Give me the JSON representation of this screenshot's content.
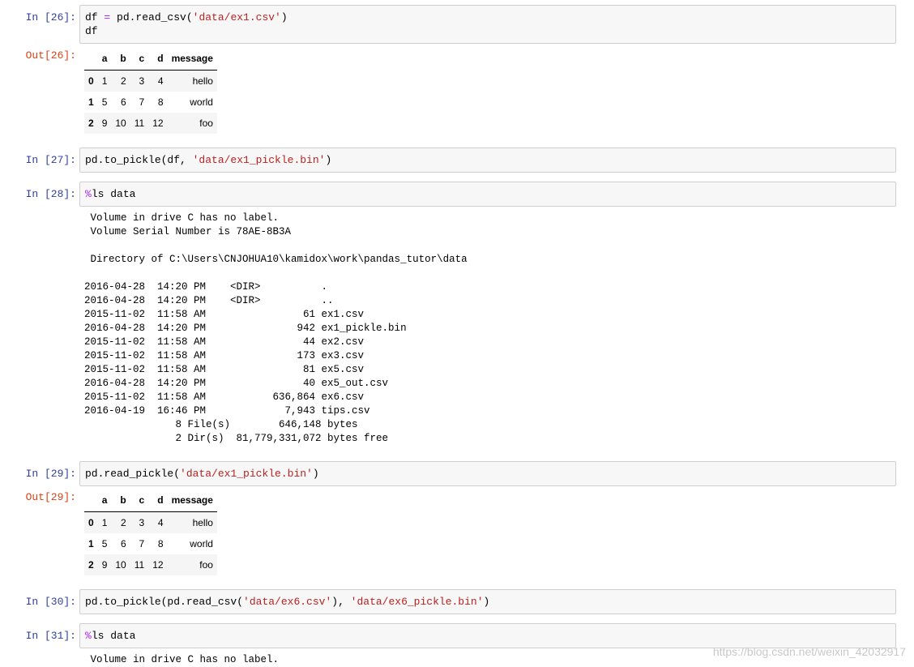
{
  "cells": [
    {
      "prompt": "In  [26]:",
      "code": [
        [
          {
            "t": "df "
          },
          {
            "t": "=",
            "c": "op"
          },
          {
            "t": " pd.read_csv("
          },
          {
            "t": "'data/ex1.csv'",
            "c": "s"
          },
          {
            "t": ")"
          }
        ],
        [
          {
            "t": "df"
          }
        ]
      ],
      "out_prompt": "Out[26]:",
      "table": {
        "columns": [
          "",
          "a",
          "b",
          "c",
          "d",
          "message"
        ],
        "rows": [
          [
            "0",
            "1",
            "2",
            "3",
            "4",
            "hello"
          ],
          [
            "1",
            "5",
            "6",
            "7",
            "8",
            "world"
          ],
          [
            "2",
            "9",
            "10",
            "11",
            "12",
            "foo"
          ]
        ]
      }
    },
    {
      "prompt": "In  [27]:",
      "code": [
        [
          {
            "t": "pd.to_pickle(df, "
          },
          {
            "t": "'data/ex1_pickle.bin'",
            "c": "s"
          },
          {
            "t": ")"
          }
        ]
      ]
    },
    {
      "prompt": "In  [28]:",
      "code": [
        [
          {
            "t": "%",
            "c": "magic"
          },
          {
            "t": "ls data"
          }
        ]
      ],
      "output_lines": [
        " Volume in drive C has no label.",
        " Volume Serial Number is 78AE-8B3A",
        "",
        " Directory of C:\\Users\\CNJOHUA10\\kamidox\\work\\pandas_tutor\\data",
        "",
        "2016-04-28  14:20 PM    <DIR>          .",
        "2016-04-28  14:20 PM    <DIR>          ..",
        "2015-11-02  11:58 AM                61 ex1.csv",
        "2016-04-28  14:20 PM               942 ex1_pickle.bin",
        "2015-11-02  11:58 AM                44 ex2.csv",
        "2015-11-02  11:58 AM               173 ex3.csv",
        "2015-11-02  11:58 AM                81 ex5.csv",
        "2016-04-28  14:20 PM                40 ex5_out.csv",
        "2015-11-02  11:58 AM           636,864 ex6.csv",
        "2016-04-19  16:46 PM             7,943 tips.csv",
        "               8 File(s)        646,148 bytes",
        "               2 Dir(s)  81,779,331,072 bytes free"
      ]
    },
    {
      "prompt": "In  [29]:",
      "code": [
        [
          {
            "t": "pd.read_pickle("
          },
          {
            "t": "'data/ex1_pickle.bin'",
            "c": "s"
          },
          {
            "t": ")"
          }
        ]
      ],
      "out_prompt": "Out[29]:",
      "table": {
        "columns": [
          "",
          "a",
          "b",
          "c",
          "d",
          "message"
        ],
        "rows": [
          [
            "0",
            "1",
            "2",
            "3",
            "4",
            "hello"
          ],
          [
            "1",
            "5",
            "6",
            "7",
            "8",
            "world"
          ],
          [
            "2",
            "9",
            "10",
            "11",
            "12",
            "foo"
          ]
        ]
      }
    },
    {
      "prompt": "In  [30]:",
      "code": [
        [
          {
            "t": "pd.to_pickle(pd.read_csv("
          },
          {
            "t": "'data/ex6.csv'",
            "c": "s"
          },
          {
            "t": "), "
          },
          {
            "t": "'data/ex6_pickle.bin'",
            "c": "s"
          },
          {
            "t": ")"
          }
        ]
      ]
    },
    {
      "prompt": "In  [31]:",
      "code": [
        [
          {
            "t": "%",
            "c": "magic"
          },
          {
            "t": "ls data"
          }
        ]
      ],
      "output_lines": [
        " Volume in drive C has no label."
      ]
    }
  ],
  "watermark": "https://blog.csdn.net/weixin_42032917",
  "colors": {
    "in_prompt": "#303f9f",
    "out_prompt": "#d84315",
    "string": "#ba2121",
    "magic": "#aa22ff",
    "cell_bg": "#f7f7f7",
    "cell_border": "#cfcfcf"
  }
}
